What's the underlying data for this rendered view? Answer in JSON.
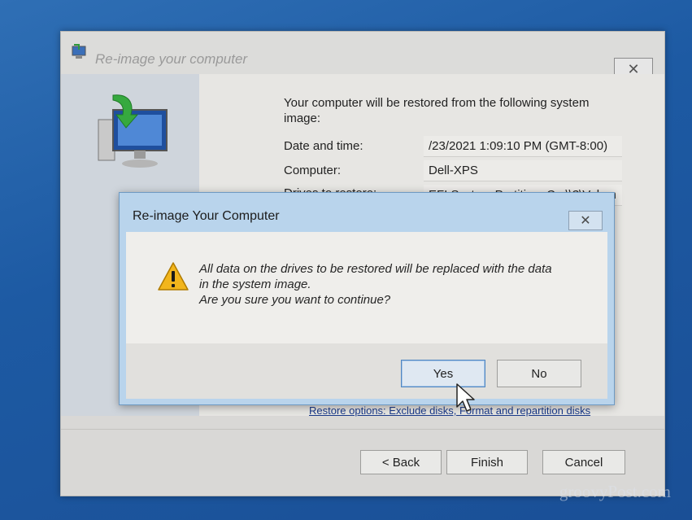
{
  "main_window": {
    "title": "Re-image your computer",
    "close_glyph": "✕",
    "intro": "Your computer will be restored from the following system image:",
    "fields": [
      {
        "label": "Date and time:",
        "value": "/23/2021 1:09:10 PM (GMT-8:00)"
      },
      {
        "label": "Computer:",
        "value": "Dell-XPS"
      },
      {
        "label": "Drives to restore:",
        "value": "EFI System Partition, C:, \\\\?\\Volum"
      }
    ],
    "restore_options_link": "Restore options: Exclude disks, Format and repartition disks",
    "buttons": {
      "back": "< Back",
      "finish": "Finish",
      "cancel": "Cancel"
    }
  },
  "dialog": {
    "title": "Re-image Your Computer",
    "close_glyph": "✕",
    "message_lines": [
      "All data on the drives to be restored will be replaced with the data",
      "in the system image.",
      "Are you sure you want to continue?"
    ],
    "buttons": {
      "yes": "Yes",
      "no": "No"
    },
    "icon": "warning-icon"
  },
  "watermark": "groovyPost.com",
  "colors": {
    "desktop": "#1d5aa3",
    "dialog_frame": "#b9d4ec",
    "default_button_border": "#4f86c2",
    "warning": "#f2b51c"
  }
}
